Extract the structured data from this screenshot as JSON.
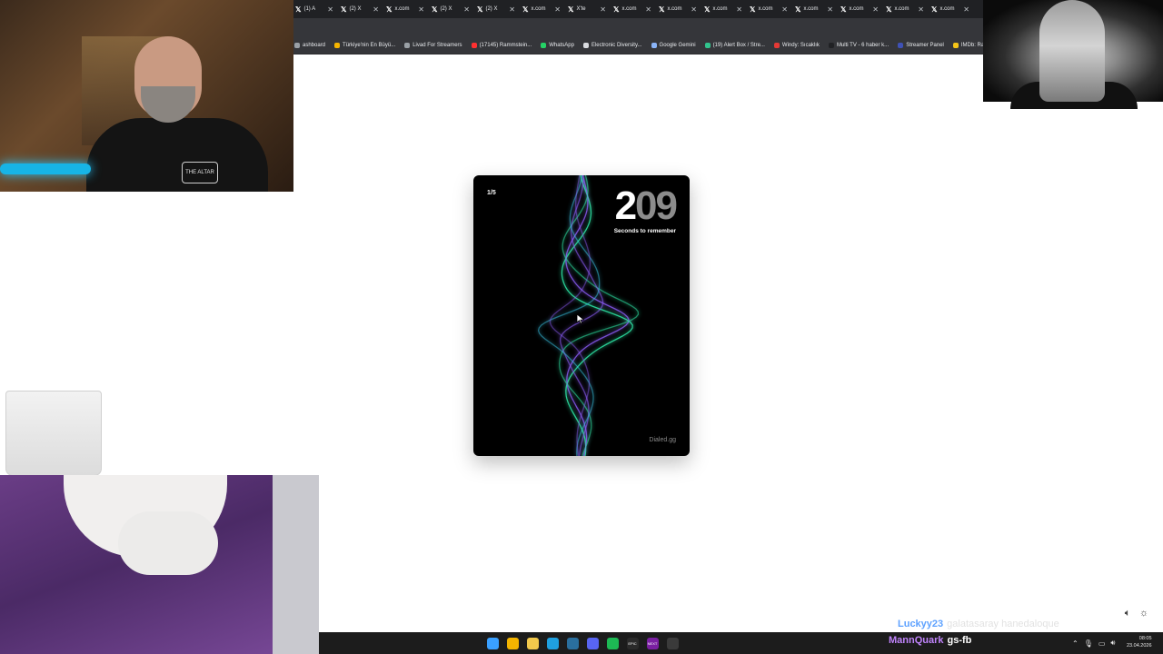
{
  "browser": {
    "tabs": [
      {
        "label": "(1) A",
        "icon": "x-logo"
      },
      {
        "label": "(2) X",
        "icon": "x-logo"
      },
      {
        "label": "x.com",
        "icon": "x-logo"
      },
      {
        "label": "(2) X",
        "icon": "x-logo"
      },
      {
        "label": "(2) X",
        "icon": "x-logo"
      },
      {
        "label": "x.com",
        "icon": "x-logo"
      },
      {
        "label": "X'te",
        "icon": "x-logo"
      },
      {
        "label": "x.com",
        "icon": "x-logo"
      },
      {
        "label": "x.com",
        "icon": "x-logo"
      },
      {
        "label": "x.com",
        "icon": "x-logo"
      },
      {
        "label": "x.com",
        "icon": "x-logo"
      },
      {
        "label": "x.com",
        "icon": "x-logo"
      },
      {
        "label": "x.com",
        "icon": "x-logo"
      },
      {
        "label": "x.com",
        "icon": "x-logo"
      },
      {
        "label": "x.com",
        "icon": "x-logo"
      }
    ],
    "bookmarks": [
      {
        "label": "ashboard",
        "color": "#9aa0a6"
      },
      {
        "label": "Türkiye'nin En Büyü...",
        "color": "#f5b400"
      },
      {
        "label": "Livad For Streamers",
        "color": "#9aa0a6"
      },
      {
        "label": "(17145) Rammstein...",
        "color": "#ff3030"
      },
      {
        "label": "WhatsApp",
        "color": "#25d366"
      },
      {
        "label": "Electronic Diversity...",
        "color": "#dadce0"
      },
      {
        "label": "Google Gemini",
        "color": "#8ab4f8"
      },
      {
        "label": "(19) Alert Box / Stre...",
        "color": "#31c48d"
      },
      {
        "label": "Windy: Sıcaklık",
        "color": "#e53935"
      },
      {
        "label": "Multi TV - 6 haber k...",
        "color": "#202124"
      },
      {
        "label": "Streamer Panel",
        "color": "#3f51b5"
      },
      {
        "label": "IMDb: Ratings",
        "color": "#f5c518"
      }
    ]
  },
  "overlays": {
    "cam_print_text": "THE ALTAR"
  },
  "game": {
    "round": "1/5",
    "timer_first": "2",
    "timer_rest": "09",
    "timer_label": "Seconds to remember",
    "brand": "Dialed.gg"
  },
  "chat": {
    "user": "Luckyy23",
    "message": "galatasaray hanedaloque"
  },
  "now_playing": {
    "user": "MannQuark",
    "text": "gs-fb"
  },
  "taskbar": {
    "icons": [
      {
        "name": "windows-start-icon",
        "glyph": "",
        "color": "#3aa0ff"
      },
      {
        "name": "chrome-icon",
        "glyph": "",
        "color": "#f4b400"
      },
      {
        "name": "file-explorer-icon",
        "glyph": "",
        "color": "#f2c94c"
      },
      {
        "name": "edge-icon",
        "glyph": "",
        "color": "#1fa0e0"
      },
      {
        "name": "steam-icon",
        "glyph": "",
        "color": "#2a6f9e"
      },
      {
        "name": "discord-icon",
        "glyph": "",
        "color": "#5865f2"
      },
      {
        "name": "spotify-icon",
        "glyph": "",
        "color": "#1db954"
      },
      {
        "name": "epic-games-icon",
        "glyph": "EPIC",
        "color": "#2a2a2a"
      },
      {
        "name": "next-app-icon",
        "glyph": "NEXT",
        "color": "#7a1fa2"
      },
      {
        "name": "obs-icon",
        "glyph": "",
        "color": "#3a3a3a"
      }
    ],
    "clock_time": "08:05",
    "clock_date": "23.04.2026"
  },
  "colors": {
    "wave_green": "#2ee6a6",
    "wave_purple": "#8b5cf6",
    "chat_user": "#5ea2ff",
    "np_user": "#c084fc"
  }
}
